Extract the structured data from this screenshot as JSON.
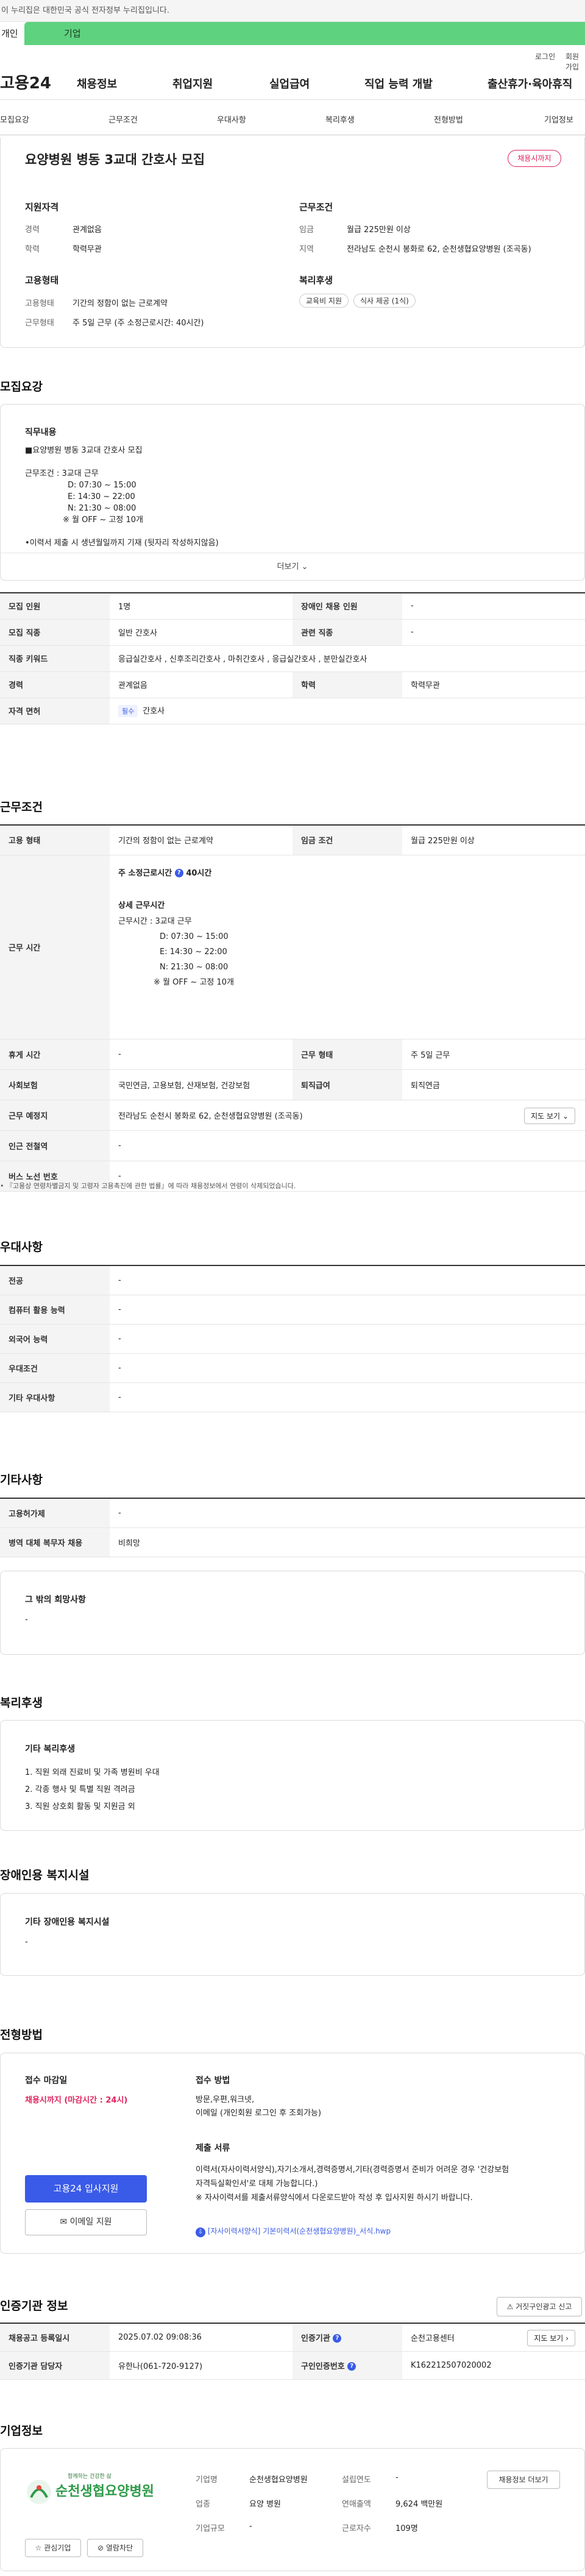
{
  "topnotice": "이 누리집은 대한민국 공식 전자정부 누리집입니다.",
  "tabs": {
    "personal": "개인",
    "company": "기업"
  },
  "util": {
    "login": "로그인",
    "signup": "회원가입"
  },
  "gnb": {
    "logo": "고용24",
    "menu": [
      "채용정보",
      "취업지원",
      "실업급여",
      "직업 능력 개발",
      "출산휴가·육아휴직"
    ]
  },
  "subnav": [
    "모집요강",
    "근무조건",
    "우대사항",
    "복리후생",
    "전형방법",
    "기업정보"
  ],
  "header": {
    "title": "요양병원 병동 3교대 간호사 모집",
    "badge": "채용시까지"
  },
  "summary": {
    "qual": {
      "title": "지원자격",
      "rows": [
        {
          "k": "경력",
          "v": "관계없음"
        },
        {
          "k": "학력",
          "v": "학력무관"
        }
      ]
    },
    "cond": {
      "title": "근무조건",
      "rows": [
        {
          "k": "임금",
          "v": "월급 225만원 이상"
        },
        {
          "k": "지역",
          "v": "전라남도 순천시 봉화로 62, 순천생협요양병원 (조곡동)"
        }
      ]
    },
    "emp": {
      "title": "고용형태",
      "rows": [
        {
          "k": "고용형태",
          "v": "기간의 정함이 없는 근로계약"
        },
        {
          "k": "근무형태",
          "v": "주 5일 근무 (주 소정근로시간: 40시간)"
        }
      ]
    },
    "welfare": {
      "title": "복리후생",
      "chips": [
        "교육비 지원",
        "식사 제공 (1식)"
      ]
    }
  },
  "recruit": {
    "title": "모집요강",
    "job_title": "직무내용",
    "job_lines": [
      "■요양병원 병동 3교대 간호사 모집",
      "",
      "근무조건 : 3교대 근무",
      "D: 07:30 ~ 15:00",
      "E: 14:30 ~ 22:00",
      "N: 21:30 ~ 08:00",
      "※ 월 OFF ~ 고정 10개",
      "",
      "•이력서 제출 시 생년월일까지 기재 (뒷자리 작성하지않음)"
    ],
    "more": "더보기",
    "rows": [
      {
        "k1": "모집 인원",
        "v1": "1명",
        "k2": "장애인 채용 인원",
        "v2": "-"
      },
      {
        "k1": "모집 직종",
        "v1": "일반 간호사",
        "k2": "관련 직종",
        "v2": "-"
      },
      {
        "k1": "직종 키워드",
        "v1": "응급실간호사 , 신후조리간호사 , 마취간호사 , 응급실간호사 , 분만실간호사"
      },
      {
        "k1": "경력",
        "v1": "관계없음",
        "k2": "학력",
        "v2": "학력무관"
      },
      {
        "k1": "자격 면허",
        "badge": "필수",
        "v1": "간호사"
      }
    ]
  },
  "workcond": {
    "title": "근무조건",
    "row1": {
      "k1": "고용 형태",
      "v1": "기간의 정함이 없는 근로계약",
      "k2": "임금 조건",
      "v2": "월급 225만원 이상"
    },
    "worktime": {
      "k": "근무 시간",
      "hours": "주 소정근로시간",
      "hours_val": "40시간",
      "detail_title": "상세 근무시간",
      "lines": [
        "근무시간 : 3교대 근무",
        "D: 07:30 ~ 15:00",
        "E: 14:30 ~ 22:00",
        "N: 21:30 ~ 08:00",
        "※ 월 OFF ~ 고정 10개"
      ]
    },
    "row3": {
      "k1": "휴게 시간",
      "v1": "-",
      "k2": "근무 형태",
      "v2": "주 5일 근무"
    },
    "row4": {
      "k1": "사회보험",
      "v1": "국민연금, 고용보험, 산재보험, 건강보험",
      "k2": "퇴직급여",
      "v2": "퇴직연금"
    },
    "row5": {
      "k1": "근무 예정지",
      "v1": "전라남도 순천시 봉화로 62, 순천생협요양병원 (조곡동)",
      "btn": "지도 보기"
    },
    "row6": {
      "k1": "인근 전철역",
      "v1": "-"
    },
    "row7": {
      "k1": "버스 노선 번호",
      "v1": "-"
    },
    "note": "• 『고용상 연령차별금지 및 고령자 고용촉진에 관한 법률』에 따라 채용정보에서 연령이 삭제되었습니다."
  },
  "pref": {
    "title": "우대사항",
    "rows": [
      {
        "k": "전공",
        "v": "-"
      },
      {
        "k": "컴퓨터 활용 능력",
        "v": "-"
      },
      {
        "k": "외국어 능력",
        "v": "-"
      },
      {
        "k": "우대조건",
        "v": "-"
      },
      {
        "k": "기타 우대사항",
        "v": "-"
      }
    ]
  },
  "etc": {
    "title": "기타사항",
    "rows": [
      {
        "k": "고용허가제",
        "v": "-"
      },
      {
        "k": "병역 대체 복무자 채용",
        "v": "비희망"
      }
    ],
    "box_title": "그 밖의 희망사항",
    "box_val": "-"
  },
  "welfare": {
    "title": "복리후생",
    "box_title": "기타 복리후생",
    "lines": [
      "1. 직원 외래 진료비 및 가족 병원비 우대",
      "2. 각종 행사 및 특별 직원 격려금",
      "3. 직원 상호회 활동 및 지원금 외"
    ]
  },
  "disabled": {
    "title": "장애인용 복지시설",
    "box_title": "기타 장애인용 복지시설",
    "box_val": "-"
  },
  "process": {
    "title": "전형방법",
    "deadline_title": "접수 마감일",
    "deadline": "채용시까지 (마감시간 : 24시)",
    "apply_btn": "고용24 입사지원",
    "email_btn": "이메일 지원",
    "method_title": "접수 방법",
    "method": "방문,우편,워크넷,",
    "method2": "이메일 (개인회원 로그인 후 조회가능)",
    "docs_title": "제출 서류",
    "docs_lines": [
      "이력서(자사이력서양식),자기소개서,경력증명서,기타(경력증명서 준비가 어려운 경우 '건강보험",
      "자격득실확인서'로 대체 가능합니다.)",
      "※ 자사이력서를 제출서류양식에서 다운로드받아 작성 후 입사지원 하시기 바랍니다."
    ],
    "file": "[자사이력서양식] 기본이력서(순천생협요양병원)_서식.hwp"
  },
  "agency": {
    "title": "인증기관 정보",
    "report_btn": "거짓구인광고 신고",
    "r1": {
      "k1": "채용공고 등록일시",
      "v1": "2025.07.02 09:08:36",
      "k2": "인증기관",
      "v2": "순천고용센터",
      "btn": "지도 보기"
    },
    "r2": {
      "k1": "인증기관 담당자",
      "v1": "유한나(061-720-9127)",
      "k2": "구인인증번호",
      "v2": "K162212507020002"
    }
  },
  "company": {
    "title": "기업정보",
    "logo_top": "함께하는 건강한 삶",
    "logo_name": "순천생협요양병원",
    "fav": "관심기업",
    "block": "열람차단",
    "rows": [
      {
        "k": "기업명",
        "v": "순천생협요양병원",
        "k2": "설립연도",
        "v2": "-"
      },
      {
        "k": "업종",
        "v": "요양 병원",
        "k2": "연매출액",
        "v2": "9,624 백만원"
      },
      {
        "k": "기업규모",
        "v": "-",
        "k2": "근로자수",
        "v2": "109명"
      }
    ],
    "jobs_btn": "채용정보 더보기"
  }
}
